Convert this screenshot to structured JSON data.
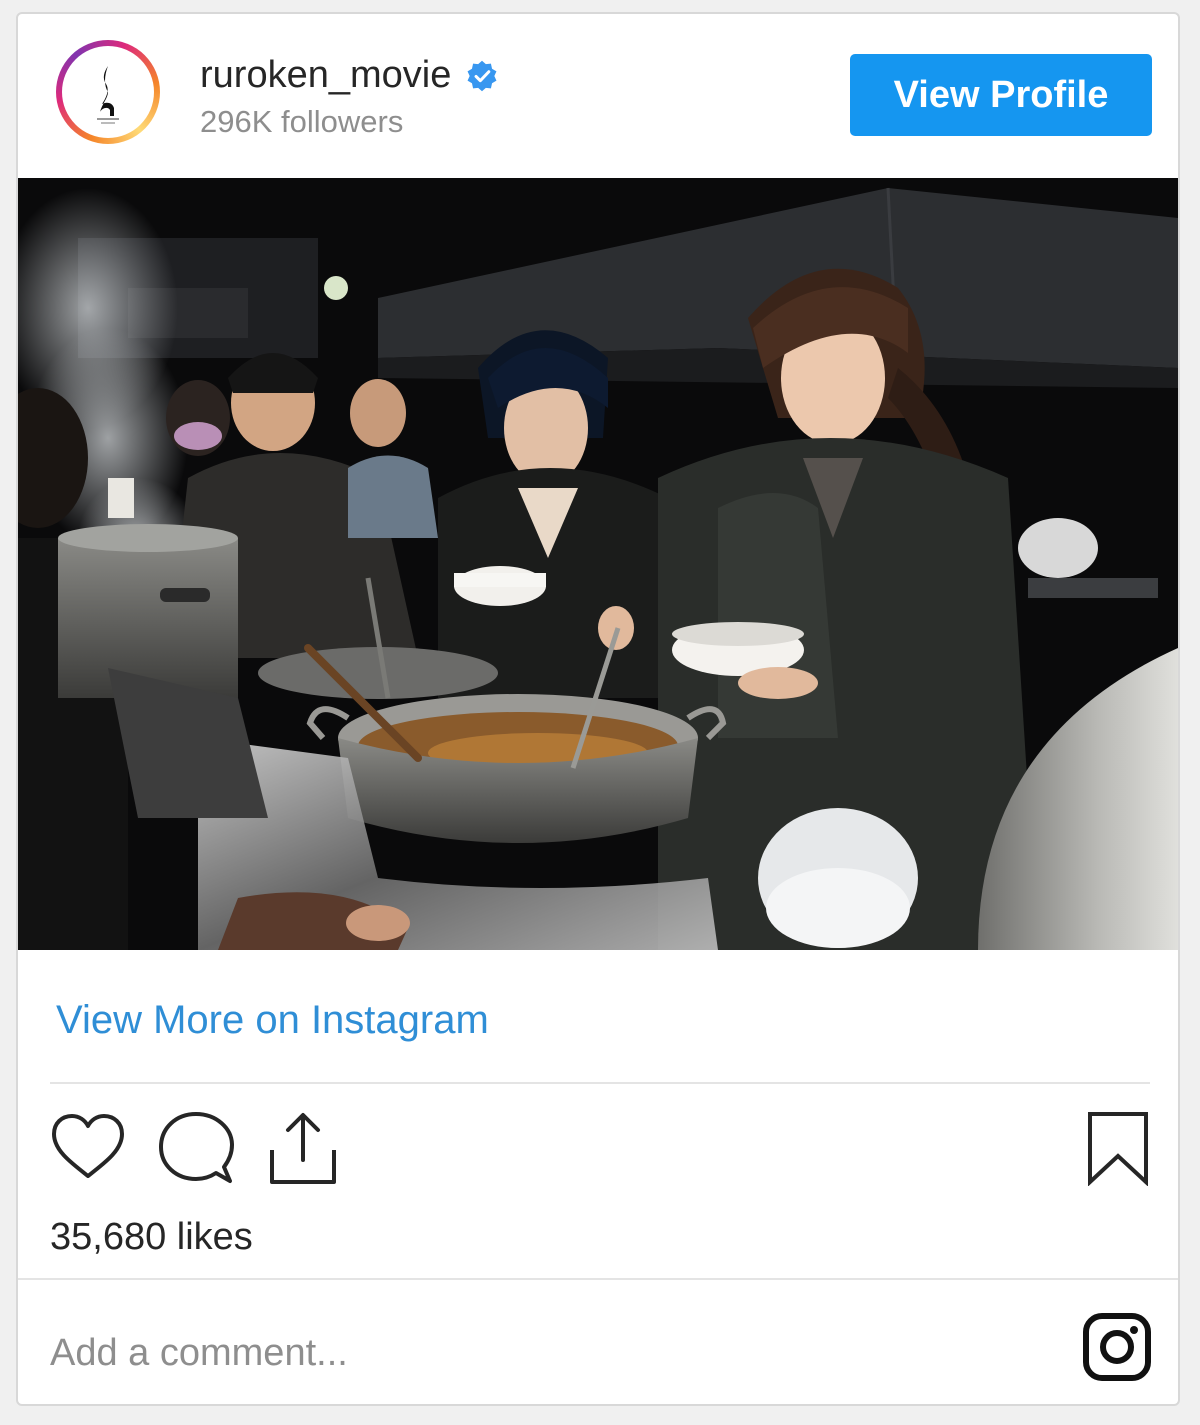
{
  "header": {
    "username": "ruroken_movie",
    "followers": "296K followers",
    "view_profile_label": "View Profile",
    "verified_icon": "verified-badge-icon"
  },
  "post": {
    "image_alt": "Cast members in dark coats holding white bowls at an outdoor night food station with large steaming pots"
  },
  "links": {
    "view_more": "View More on Instagram"
  },
  "actions": {
    "icons": [
      "heart-icon",
      "comment-icon",
      "share-icon",
      "bookmark-icon"
    ]
  },
  "stats": {
    "likes": "35,680 likes"
  },
  "comment": {
    "placeholder": "Add a comment...",
    "icon": "instagram-icon"
  },
  "colors": {
    "accent": "#1596f0",
    "link": "#2f8ed6",
    "text": "#262626",
    "muted": "#8e8e8e"
  }
}
